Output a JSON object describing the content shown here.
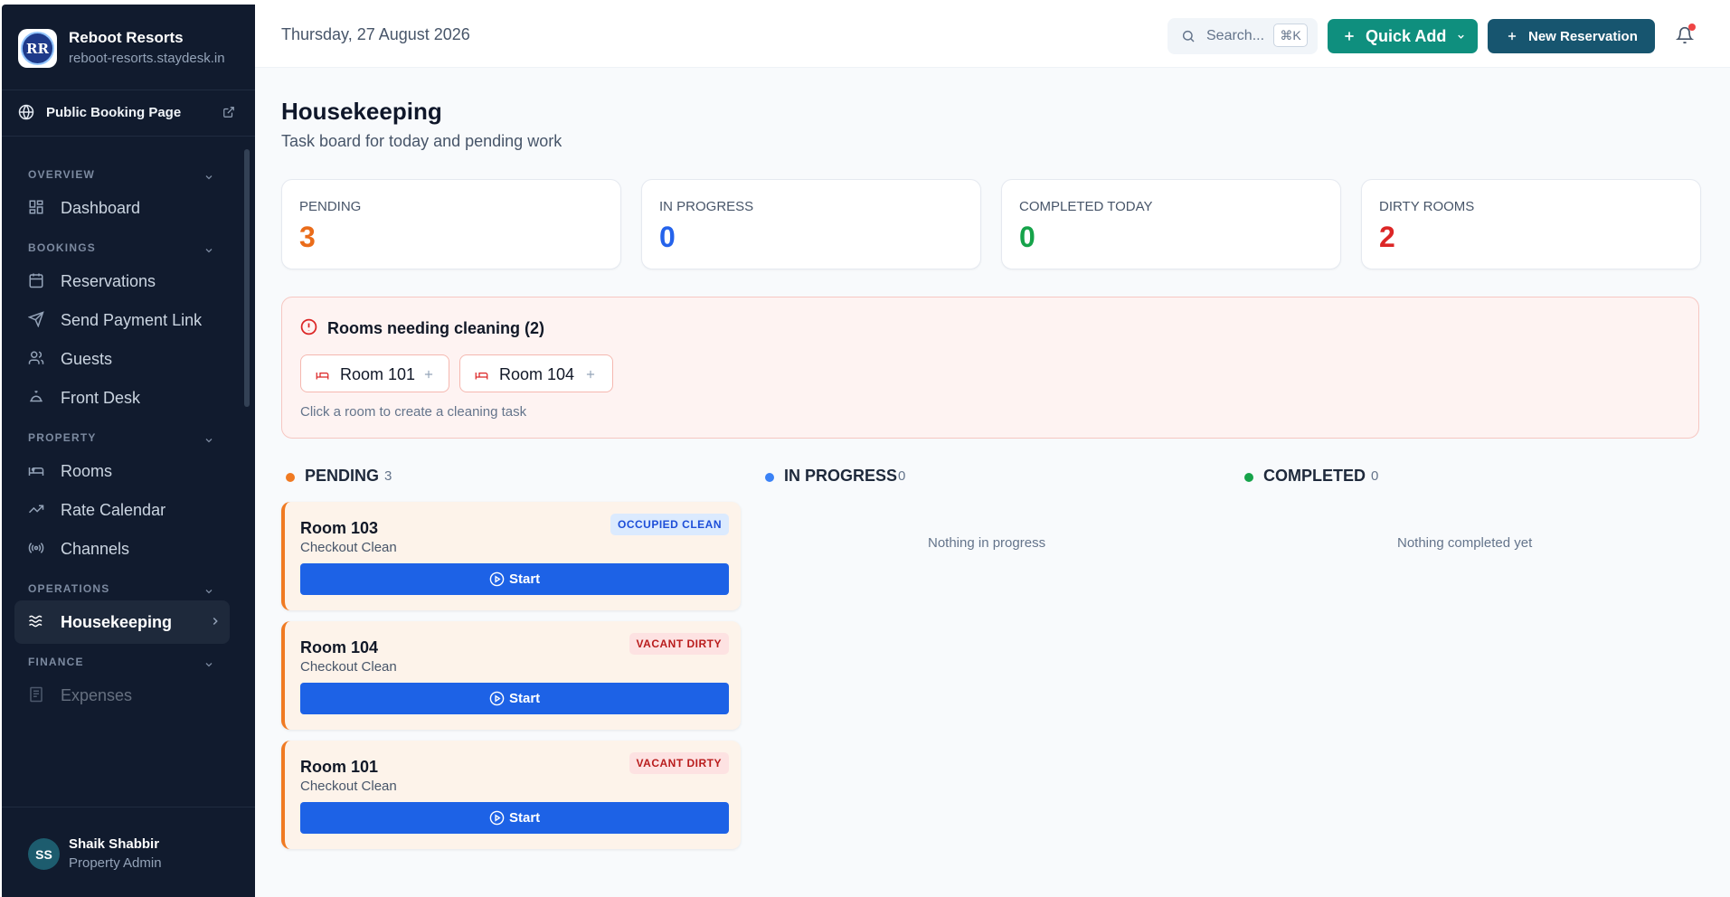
{
  "app": {
    "name": "Reboot Resorts",
    "domain": "reboot-resorts.staydesk.in",
    "logo_text": "RR"
  },
  "public_booking": "Public Booking Page",
  "nav": {
    "sections": [
      {
        "title": "OVERVIEW",
        "items": [
          "Dashboard"
        ]
      },
      {
        "title": "BOOKINGS",
        "items": [
          "Reservations",
          "Send Payment Link",
          "Guests",
          "Front Desk"
        ]
      },
      {
        "title": "PROPERTY",
        "items": [
          "Rooms",
          "Rate Calendar",
          "Channels"
        ]
      },
      {
        "title": "OPERATIONS",
        "items": [
          "Housekeeping"
        ]
      },
      {
        "title": "FINANCE",
        "items": [
          "Expenses"
        ]
      }
    ],
    "active": "Housekeeping"
  },
  "user": {
    "initials": "SS",
    "name": "Shaik Shabbir",
    "role": "Property Admin"
  },
  "topbar": {
    "date": "Thursday, 27 August 2026",
    "search_placeholder": "Search...",
    "shortcut": "⌘K",
    "quick_add": "Quick Add",
    "new_reservation": "New Reservation"
  },
  "page": {
    "title": "Housekeeping",
    "subtitle": "Task board for today and pending work"
  },
  "stats": [
    {
      "label": "PENDING",
      "value": "3",
      "color": "#ea6c1a"
    },
    {
      "label": "IN PROGRESS",
      "value": "0",
      "color": "#2563eb"
    },
    {
      "label": "COMPLETED TODAY",
      "value": "0",
      "color": "#16a34a"
    },
    {
      "label": "DIRTY ROOMS",
      "value": "2",
      "color": "#dc2626"
    }
  ],
  "alert": {
    "title": "Rooms needing cleaning (2)",
    "rooms": [
      "Room 101",
      "Room 104"
    ],
    "hint": "Click a room to create a cleaning task"
  },
  "columns": [
    {
      "name": "PENDING",
      "count": "3",
      "color": "#f07a22"
    },
    {
      "name": "IN PROGRESS",
      "count": "0",
      "color": "#3b82f6",
      "empty": "Nothing in progress"
    },
    {
      "name": "COMPLETED",
      "count": "0",
      "color": "#16a34a",
      "empty": "Nothing completed yet"
    }
  ],
  "tasks": [
    {
      "room": "Room 103",
      "type": "Checkout Clean",
      "status": "OCCUPIED CLEAN",
      "action": "Start"
    },
    {
      "room": "Room 104",
      "type": "Checkout Clean",
      "status": "VACANT DIRTY",
      "action": "Start"
    },
    {
      "room": "Room 101",
      "type": "Checkout Clean",
      "status": "VACANT DIRTY",
      "action": "Start"
    }
  ]
}
